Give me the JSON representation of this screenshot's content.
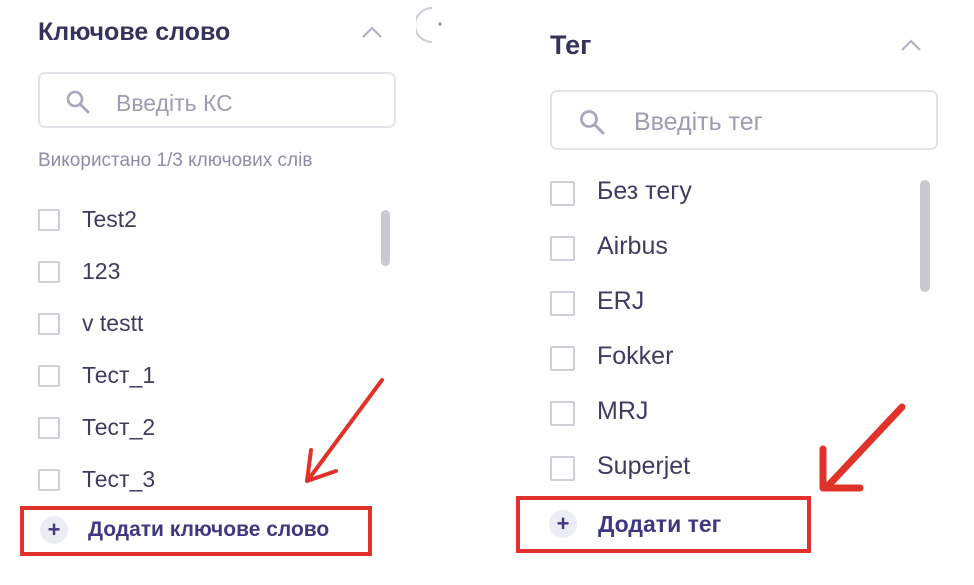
{
  "keyword_panel": {
    "title": "Ключове слово",
    "search_placeholder": "Введіть КС",
    "usage_text": "Використано 1/3 ключових слів",
    "items": [
      {
        "label": "Test2",
        "checked": false
      },
      {
        "label": "123",
        "checked": false
      },
      {
        "label": "v testt",
        "checked": false
      },
      {
        "label": "Тест_1",
        "checked": false
      },
      {
        "label": "Тест_2",
        "checked": false
      },
      {
        "label": "Тест_3",
        "checked": false
      }
    ],
    "add_button_icon": "+",
    "add_button_label": "Додати ключове слово"
  },
  "tag_panel": {
    "title": "Тег",
    "search_placeholder": "Введіть тег",
    "items": [
      {
        "label": "Без тегу",
        "checked": false
      },
      {
        "label": "Airbus",
        "checked": false
      },
      {
        "label": "ERJ",
        "checked": false
      },
      {
        "label": "Fokker",
        "checked": false
      },
      {
        "label": "MRJ",
        "checked": false
      },
      {
        "label": "Superjet",
        "checked": false
      }
    ],
    "add_button_icon": "+",
    "add_button_label": "Додати тег"
  },
  "icons": {
    "collapse": "chevron-up-icon",
    "search": "search-icon",
    "add": "plus-icon",
    "loader": "spinner-icon",
    "annotation": "red-arrow-icon"
  },
  "colors": {
    "text_primary": "#35335a",
    "accent": "#3d3880",
    "annotation_red": "#e03228",
    "border": "#e3e3ea",
    "muted": "#8e8da5"
  }
}
